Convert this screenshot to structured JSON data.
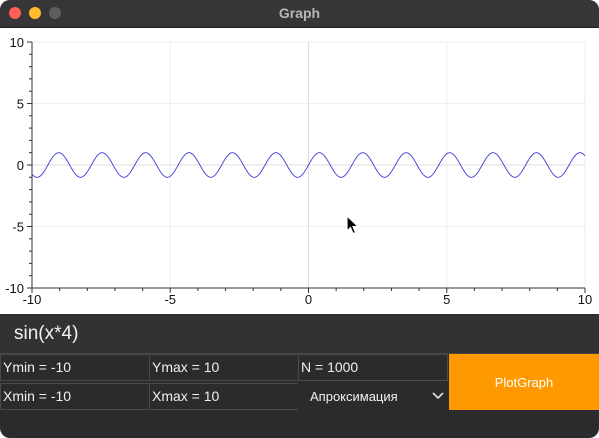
{
  "window": {
    "title": "Graph"
  },
  "plot": {
    "x_ticks": [
      "-10",
      "-5",
      "0",
      "5",
      "10"
    ],
    "y_ticks": [
      "10",
      "5",
      "0",
      "-5",
      "-10"
    ]
  },
  "chart_data": {
    "type": "line",
    "title": "",
    "xlabel": "",
    "ylabel": "",
    "xlim": [
      -10,
      10
    ],
    "ylim": [
      -10,
      10
    ],
    "grid": true,
    "function": "sin(x*4)",
    "series": [
      {
        "color": "#3a3ad8",
        "x": [
          -10,
          10
        ]
      }
    ],
    "x_tick_values": [
      -10,
      -5,
      0,
      5,
      10
    ],
    "y_tick_values": [
      -10,
      -5,
      0,
      5,
      10
    ]
  },
  "controls": {
    "expression": "sin(x*4)",
    "ymin": "Ymin = -10",
    "ymax": "Ymax = 10",
    "n": "N = 1000",
    "xmin": "Xmin = -10",
    "xmax": "Xmax = 10",
    "method": "Апроксимация",
    "plot_button": "PlotGraph"
  },
  "colors": {
    "accent": "#fe9a00",
    "curve": "#3a3ad8"
  }
}
